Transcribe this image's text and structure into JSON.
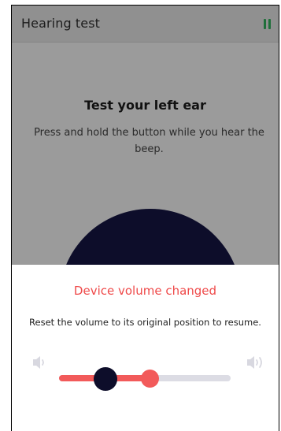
{
  "app": {
    "title": "Hearing test",
    "heading": "Test your left ear",
    "instructions": "Press and hold the button while you hear the beep."
  },
  "dialog": {
    "title": "Device volume changed",
    "message": "Reset the volume to its original position to resume."
  },
  "volume": {
    "current_level": 0.53,
    "original_level": 0.27
  },
  "icons": {
    "pause": "pause-icon",
    "volume_low": "volume-low-icon",
    "volume_high": "volume-high-icon"
  },
  "colors": {
    "accent": "#f25a5a",
    "dark": "#0d0d2a",
    "pause": "#1f6f3a",
    "track": "#dcdce4"
  }
}
